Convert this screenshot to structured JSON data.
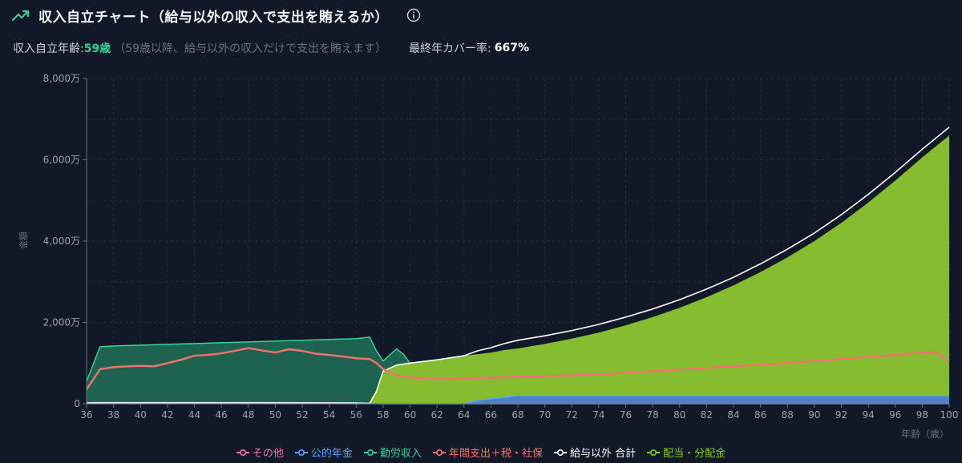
{
  "header": {
    "title": "収入自立チャート（給与以外の収入で支出を賄えるか）"
  },
  "stats": {
    "age_label": "収入自立年齢:",
    "age_value": "59歳",
    "age_note": "（59歳以降、給与以外の収入だけで支出を賄えます）",
    "rate_label": "最終年カバー率:",
    "rate_value": "667%"
  },
  "chart_data": {
    "type": "area",
    "title": "",
    "xlabel": "年齢（歳）",
    "ylabel": "金額",
    "xlim": [
      36,
      100
    ],
    "ylim": [
      0,
      8000
    ],
    "x_ticks": [
      "36",
      "38",
      "40",
      "42",
      "44",
      "46",
      "48",
      "50",
      "52",
      "54",
      "56",
      "58",
      "60",
      "62",
      "64",
      "66",
      "68",
      "70",
      "72",
      "74",
      "76",
      "78",
      "80",
      "82",
      "84",
      "86",
      "88",
      "90",
      "92",
      "94",
      "96",
      "98",
      "100"
    ],
    "y_ticks": [
      "0",
      "2,000万",
      "4,000万",
      "6,000万",
      "8,000万"
    ],
    "grid": true,
    "legend_position": "bottom",
    "series": [
      {
        "name": "その他",
        "color": "#f472b6",
        "kind": "area",
        "x": [
          36,
          37,
          38,
          40,
          45,
          50,
          55,
          57,
          58,
          100
        ],
        "values": [
          20,
          30,
          30,
          30,
          30,
          30,
          20,
          10,
          0,
          0
        ]
      },
      {
        "name": "公的年金",
        "color": "#60a5fa",
        "kind": "area",
        "x": [
          36,
          64,
          65,
          66,
          67,
          68,
          100
        ],
        "values": [
          0,
          0,
          80,
          120,
          160,
          200,
          200
        ]
      },
      {
        "name": "勤労収入",
        "color": "#34d399",
        "kind": "area",
        "x": [
          36,
          37,
          38,
          40,
          44,
          48,
          52,
          56,
          57,
          57.5,
          58,
          58.5,
          59,
          59.5,
          60
        ],
        "values": [
          550,
          1400,
          1420,
          1440,
          1480,
          1520,
          1560,
          1600,
          1640,
          1300,
          1050,
          1200,
          1350,
          1220,
          1000
        ]
      },
      {
        "name": "年間支出＋税・社保",
        "color": "#f87171",
        "kind": "line",
        "x": [
          36,
          36.5,
          37,
          38,
          39,
          40,
          41,
          42,
          43,
          44,
          45,
          46,
          47,
          48,
          49,
          50,
          51,
          52,
          53,
          54,
          55,
          56,
          57,
          57.5,
          58,
          59,
          60,
          62,
          64,
          66,
          68,
          70,
          72,
          74,
          76,
          78,
          80,
          82,
          84,
          86,
          88,
          90,
          92,
          94,
          96,
          98,
          99,
          100
        ],
        "values": [
          350,
          600,
          850,
          900,
          920,
          930,
          920,
          1000,
          1080,
          1180,
          1200,
          1240,
          1300,
          1370,
          1310,
          1260,
          1340,
          1300,
          1230,
          1200,
          1160,
          1120,
          1100,
          1000,
          850,
          700,
          650,
          600,
          620,
          640,
          660,
          680,
          700,
          720,
          760,
          800,
          840,
          880,
          920,
          960,
          1000,
          1050,
          1100,
          1150,
          1200,
          1260,
          1280,
          1020
        ]
      },
      {
        "name": "給与以外 合計",
        "color": "#ffffff",
        "kind": "line",
        "x": [
          36,
          56,
          57,
          57.5,
          58,
          59,
          60,
          62,
          64,
          65,
          66,
          67,
          68,
          70,
          72,
          74,
          76,
          78,
          80,
          82,
          84,
          86,
          88,
          90,
          92,
          94,
          96,
          98,
          100
        ],
        "values": [
          20,
          20,
          10,
          300,
          800,
          950,
          1000,
          1080,
          1180,
          1300,
          1380,
          1480,
          1560,
          1670,
          1800,
          1950,
          2130,
          2330,
          2560,
          2820,
          3110,
          3440,
          3800,
          4200,
          4650,
          5150,
          5690,
          6260,
          6800
        ]
      },
      {
        "name": "配当・分配金",
        "color": "#84cc16",
        "kind": "area",
        "x": [
          36,
          57,
          57.5,
          58,
          59,
          60,
          62,
          64,
          65,
          66,
          67,
          68,
          70,
          72,
          74,
          76,
          78,
          80,
          82,
          84,
          86,
          88,
          90,
          92,
          94,
          96,
          98,
          100
        ],
        "values": [
          0,
          0,
          300,
          800,
          950,
          1000,
          1080,
          1180,
          1220,
          1260,
          1320,
          1360,
          1470,
          1600,
          1750,
          1930,
          2130,
          2360,
          2620,
          2910,
          3240,
          3600,
          4000,
          4450,
          4950,
          5490,
          6060,
          6600
        ]
      }
    ]
  }
}
